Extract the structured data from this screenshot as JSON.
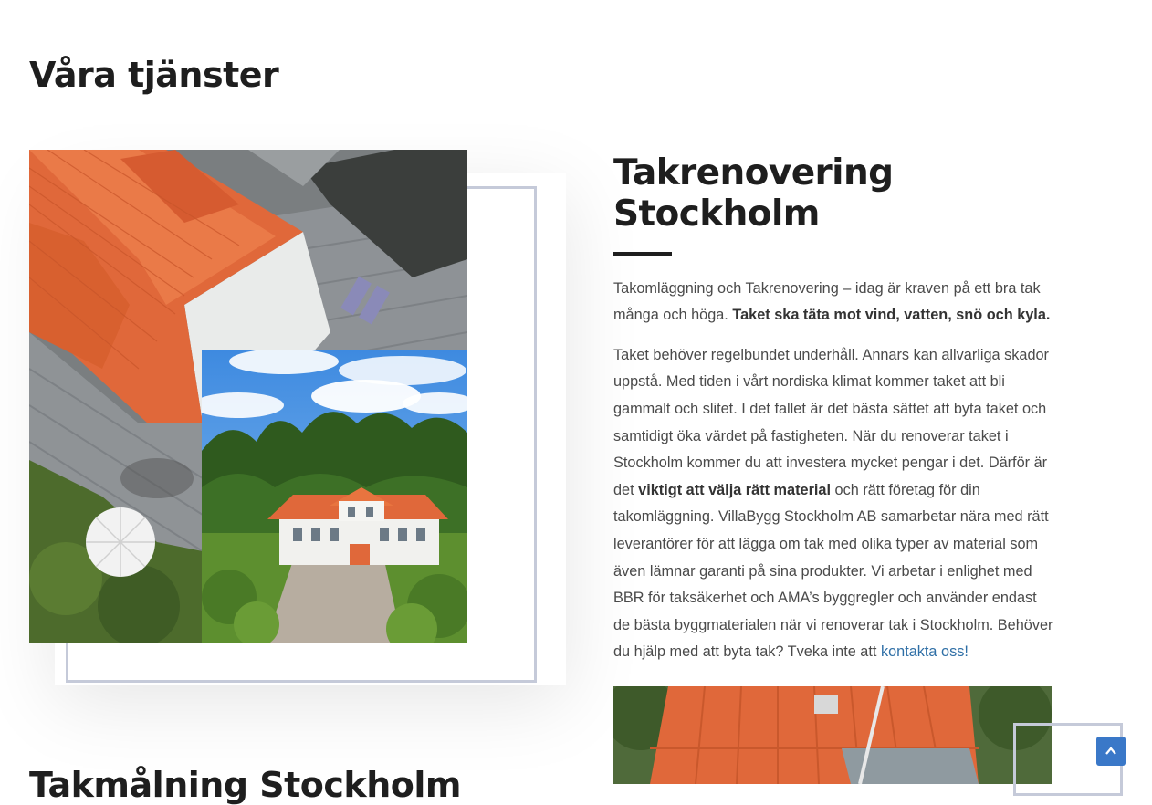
{
  "section": {
    "title": "Våra tjänster"
  },
  "service": {
    "title": "Takrenovering Stockholm",
    "intro_plain": "Takomläggning och Takrenovering – idag är kraven på ett bra tak många och höga. ",
    "intro_bold": "Taket ska täta mot vind, vatten, snö och kyla.",
    "body_part1": "Taket behöver regelbundet underhåll. Annars kan allvarliga skador uppstå. Med tiden i vårt nordiska klimat kommer taket att bli gammalt och slitet. I det fallet är det bästa sättet att byta taket och samtidigt öka värdet på fastigheten. När du renoverar taket i Stockholm kommer du att investera mycket pengar i det. Därför är det ",
    "body_bold": "viktigt att välja rätt material",
    "body_part2": " och rätt företag för din takomläggning. VillaBygg Stockholm AB samarbetar nära med rätt leverantörer för att lägga om tak med olika typer av material som även lämnar garanti på sina produkter. Vi arbetar i enlighet med BBR för taksäkerhet och AMA’s byggregler och använder endast de bästa byggmaterialen när vi renoverar tak i Stockholm. Behöver du hjälp med att byta tak? Tveka inte att ",
    "contact_link": "kontakta oss!"
  },
  "next_service": {
    "title": "Takmålning Stockholm"
  },
  "icons": {
    "scroll_top": "chevron-up-icon"
  },
  "colors": {
    "accent": "#3a78c8",
    "link": "#2f6fa6",
    "frame": "#c5cad9",
    "roof": "#e0683a"
  }
}
